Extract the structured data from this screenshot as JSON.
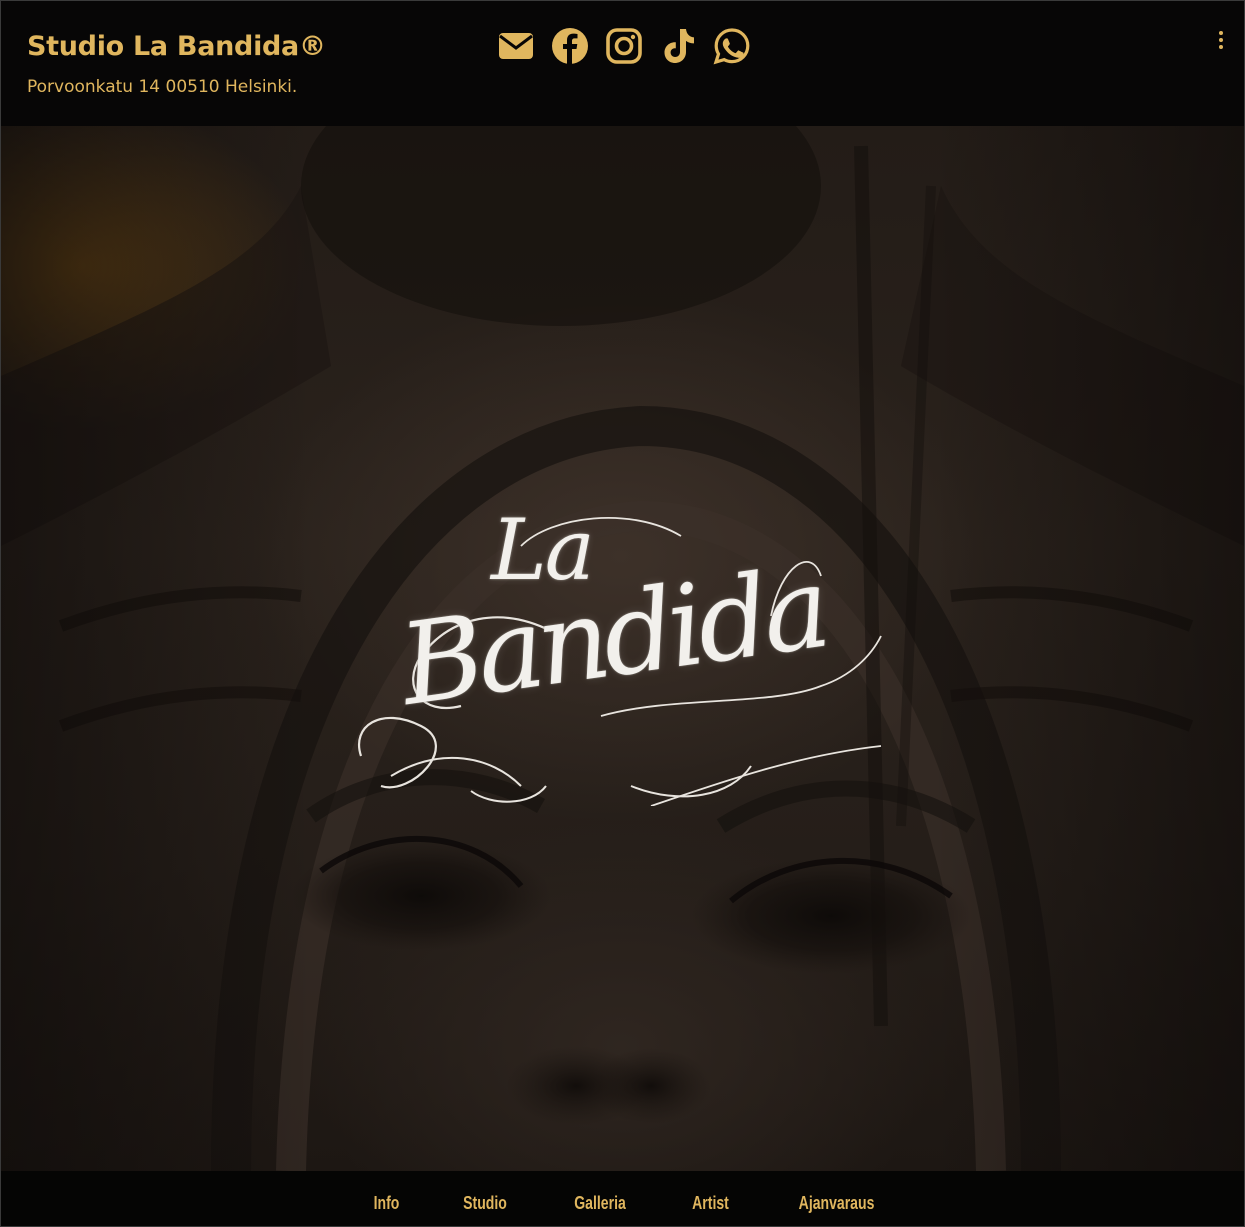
{
  "header": {
    "brand": "Studio La Bandida®",
    "address": "Porvoonkatu 14 00510 Helsinki.",
    "socials": [
      "envelope-icon",
      "facebook-icon",
      "instagram-icon",
      "tiktok-icon",
      "whatsapp-icon"
    ],
    "menu_icon": "kebab-menu-icon"
  },
  "hero": {
    "logo_line1": "La",
    "logo_line2": "Bandida"
  },
  "nav": {
    "items": [
      "Info",
      "Studio",
      "Galleria",
      "Artist",
      "Ajanvaraus"
    ]
  },
  "colors": {
    "accent": "#e0b65e",
    "background": "#070605",
    "logo": "#f2f0ec"
  }
}
